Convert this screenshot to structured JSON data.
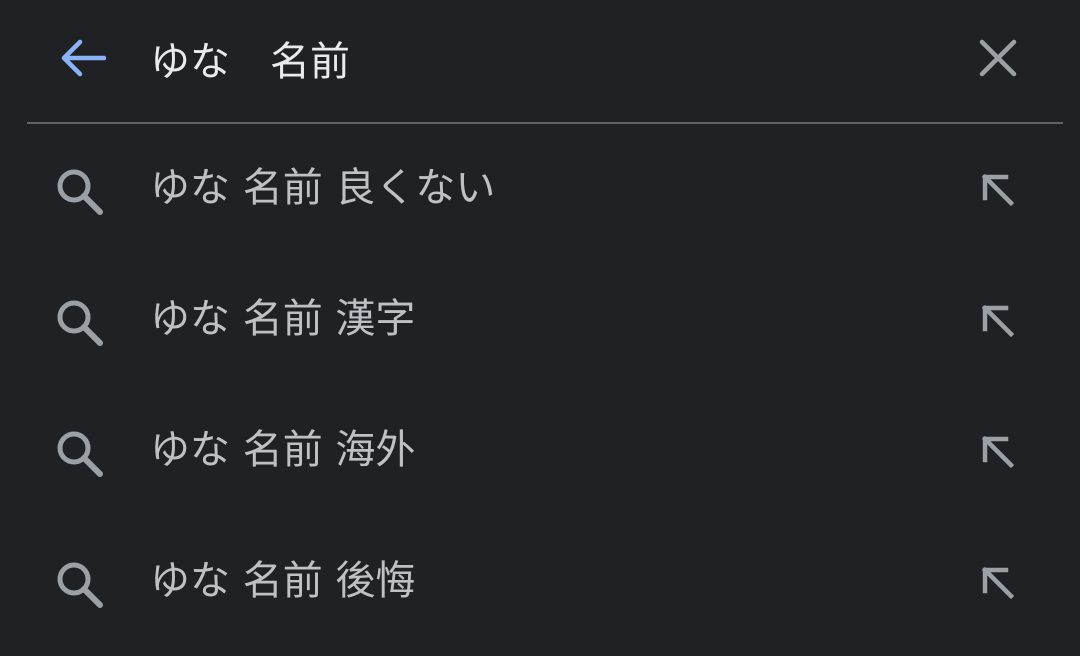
{
  "colors": {
    "background": "#202124",
    "accent": "#8ab4f8",
    "query_text": "#e8eaed",
    "suggestion_text": "#bdc1c6",
    "icon": "#9aa0a6",
    "divider": "#5f6368"
  },
  "search": {
    "back_icon": "arrow-left-icon",
    "query": "ゆな　名前",
    "clear_icon": "close-icon"
  },
  "suggestions": [
    {
      "icon": "search-icon",
      "text": "ゆな 名前 良くない",
      "fill_icon": "arrow-up-left-icon"
    },
    {
      "icon": "search-icon",
      "text": "ゆな 名前 漢字",
      "fill_icon": "arrow-up-left-icon"
    },
    {
      "icon": "search-icon",
      "text": "ゆな 名前 海外",
      "fill_icon": "arrow-up-left-icon"
    },
    {
      "icon": "search-icon",
      "text": "ゆな 名前 後悔",
      "fill_icon": "arrow-up-left-icon"
    }
  ]
}
